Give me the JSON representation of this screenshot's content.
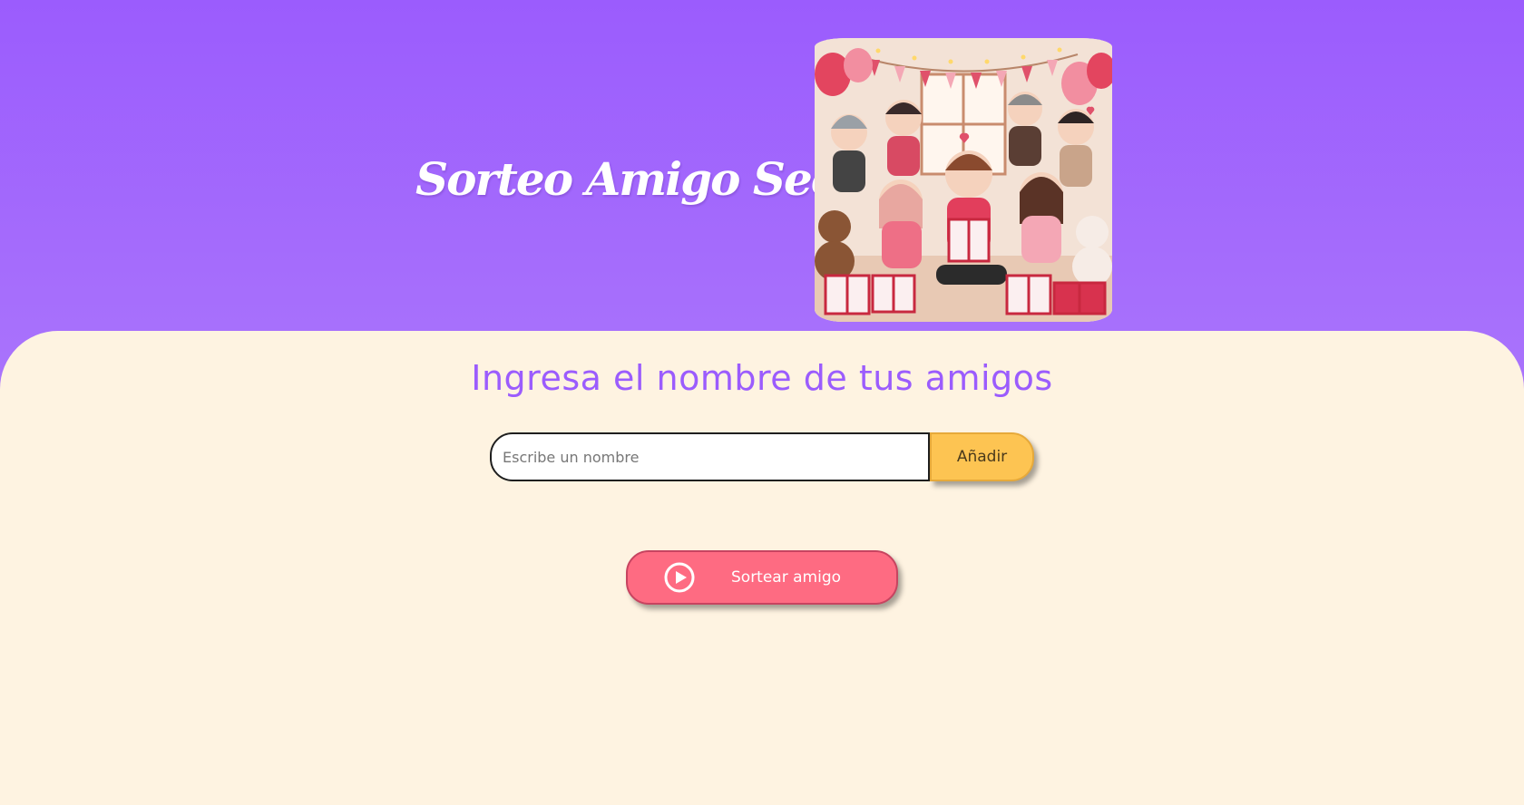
{
  "header": {
    "title": "Sorteo Amigo Secreto",
    "image_alt": "Ilustración de amigos intercambiando regalos"
  },
  "main": {
    "subtitle": "Ingresa el nombre de tus amigos",
    "input": {
      "placeholder": "Escribe un nombre",
      "value": ""
    },
    "add_button_label": "Añadir",
    "draw_button_label": "Sortear amigo",
    "draw_button_icon": "play-circle-icon"
  },
  "colors": {
    "header_gradient_top": "#9b5cfd",
    "header_gradient_bottom": "#b98dfb",
    "main_background": "#fef3e1",
    "subtitle": "#9b5cfd",
    "add_button": "#fdc452",
    "draw_button": "#fe6b82"
  }
}
